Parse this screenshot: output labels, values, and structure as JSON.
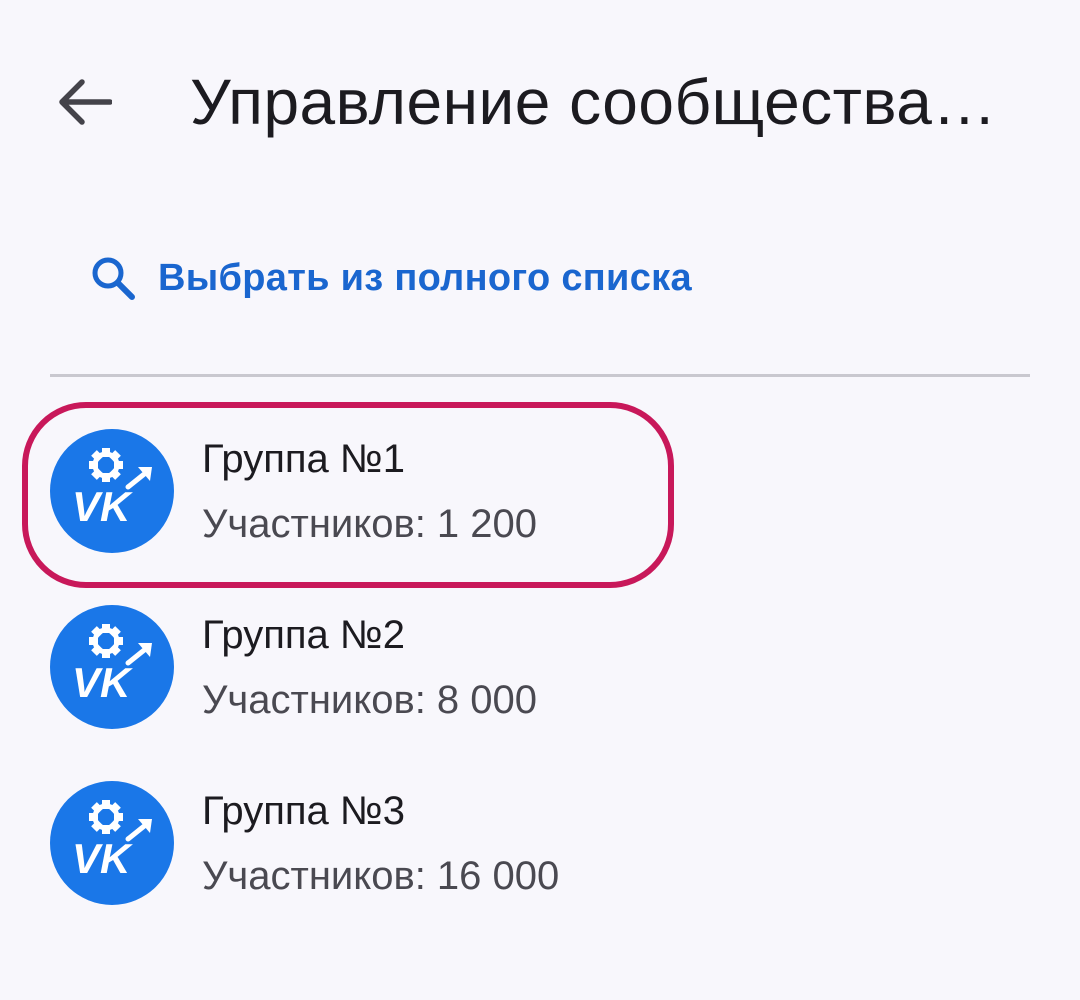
{
  "header": {
    "title": "Управление сообщества…",
    "back_icon": "arrow-back-icon"
  },
  "search": {
    "label": "Выбрать из полного списка",
    "icon": "search-icon",
    "color": "#1a66cf"
  },
  "groups": [
    {
      "name": "Группа №1",
      "members": "Участников: 1 200",
      "highlighted": true
    },
    {
      "name": "Группа №2",
      "members": "Участников: 8 000",
      "highlighted": false
    },
    {
      "name": "Группа №3",
      "members": "Участников: 16 000",
      "highlighted": false
    }
  ],
  "avatar": {
    "icon": "vk-manage-logo-icon",
    "text": "VK",
    "color": "#1a77e8"
  },
  "highlight_color": "#c8185a"
}
